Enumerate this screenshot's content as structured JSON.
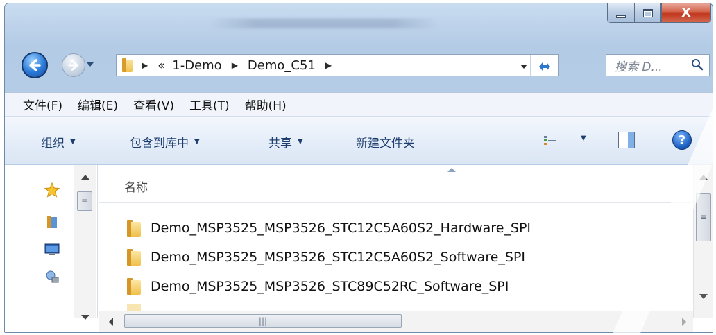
{
  "window": {
    "close_label": "X"
  },
  "nav": {
    "breadcrumb_overflow": "«",
    "breadcrumb": [
      "1-Demo",
      "Demo_C51"
    ],
    "search_placeholder": "搜索 D..."
  },
  "menubar": {
    "items": [
      "文件(F)",
      "编辑(E)",
      "查看(V)",
      "工具(T)",
      "帮助(H)"
    ]
  },
  "commandbar": {
    "organize": "组织",
    "include_in_library": "包含到库中",
    "share": "共享",
    "new_folder": "新建文件夹",
    "help": "?"
  },
  "filelist": {
    "column_name": "名称",
    "items": [
      "Demo_MSP3525_MSP3526_STC12C5A60S2_Hardware_SPI",
      "Demo_MSP3525_MSP3526_STC12C5A60S2_Software_SPI",
      "Demo_MSP3525_MSP3526_STC89C52RC_Software_SPI"
    ]
  },
  "navpane": {
    "icons": [
      "favorites-star-icon",
      "libraries-icon",
      "computer-icon",
      "network-icon"
    ]
  },
  "colors": {
    "title_gradient_top": "#c9dcf0",
    "close_button": "#c1381d",
    "command_text": "#1d3e6e"
  }
}
